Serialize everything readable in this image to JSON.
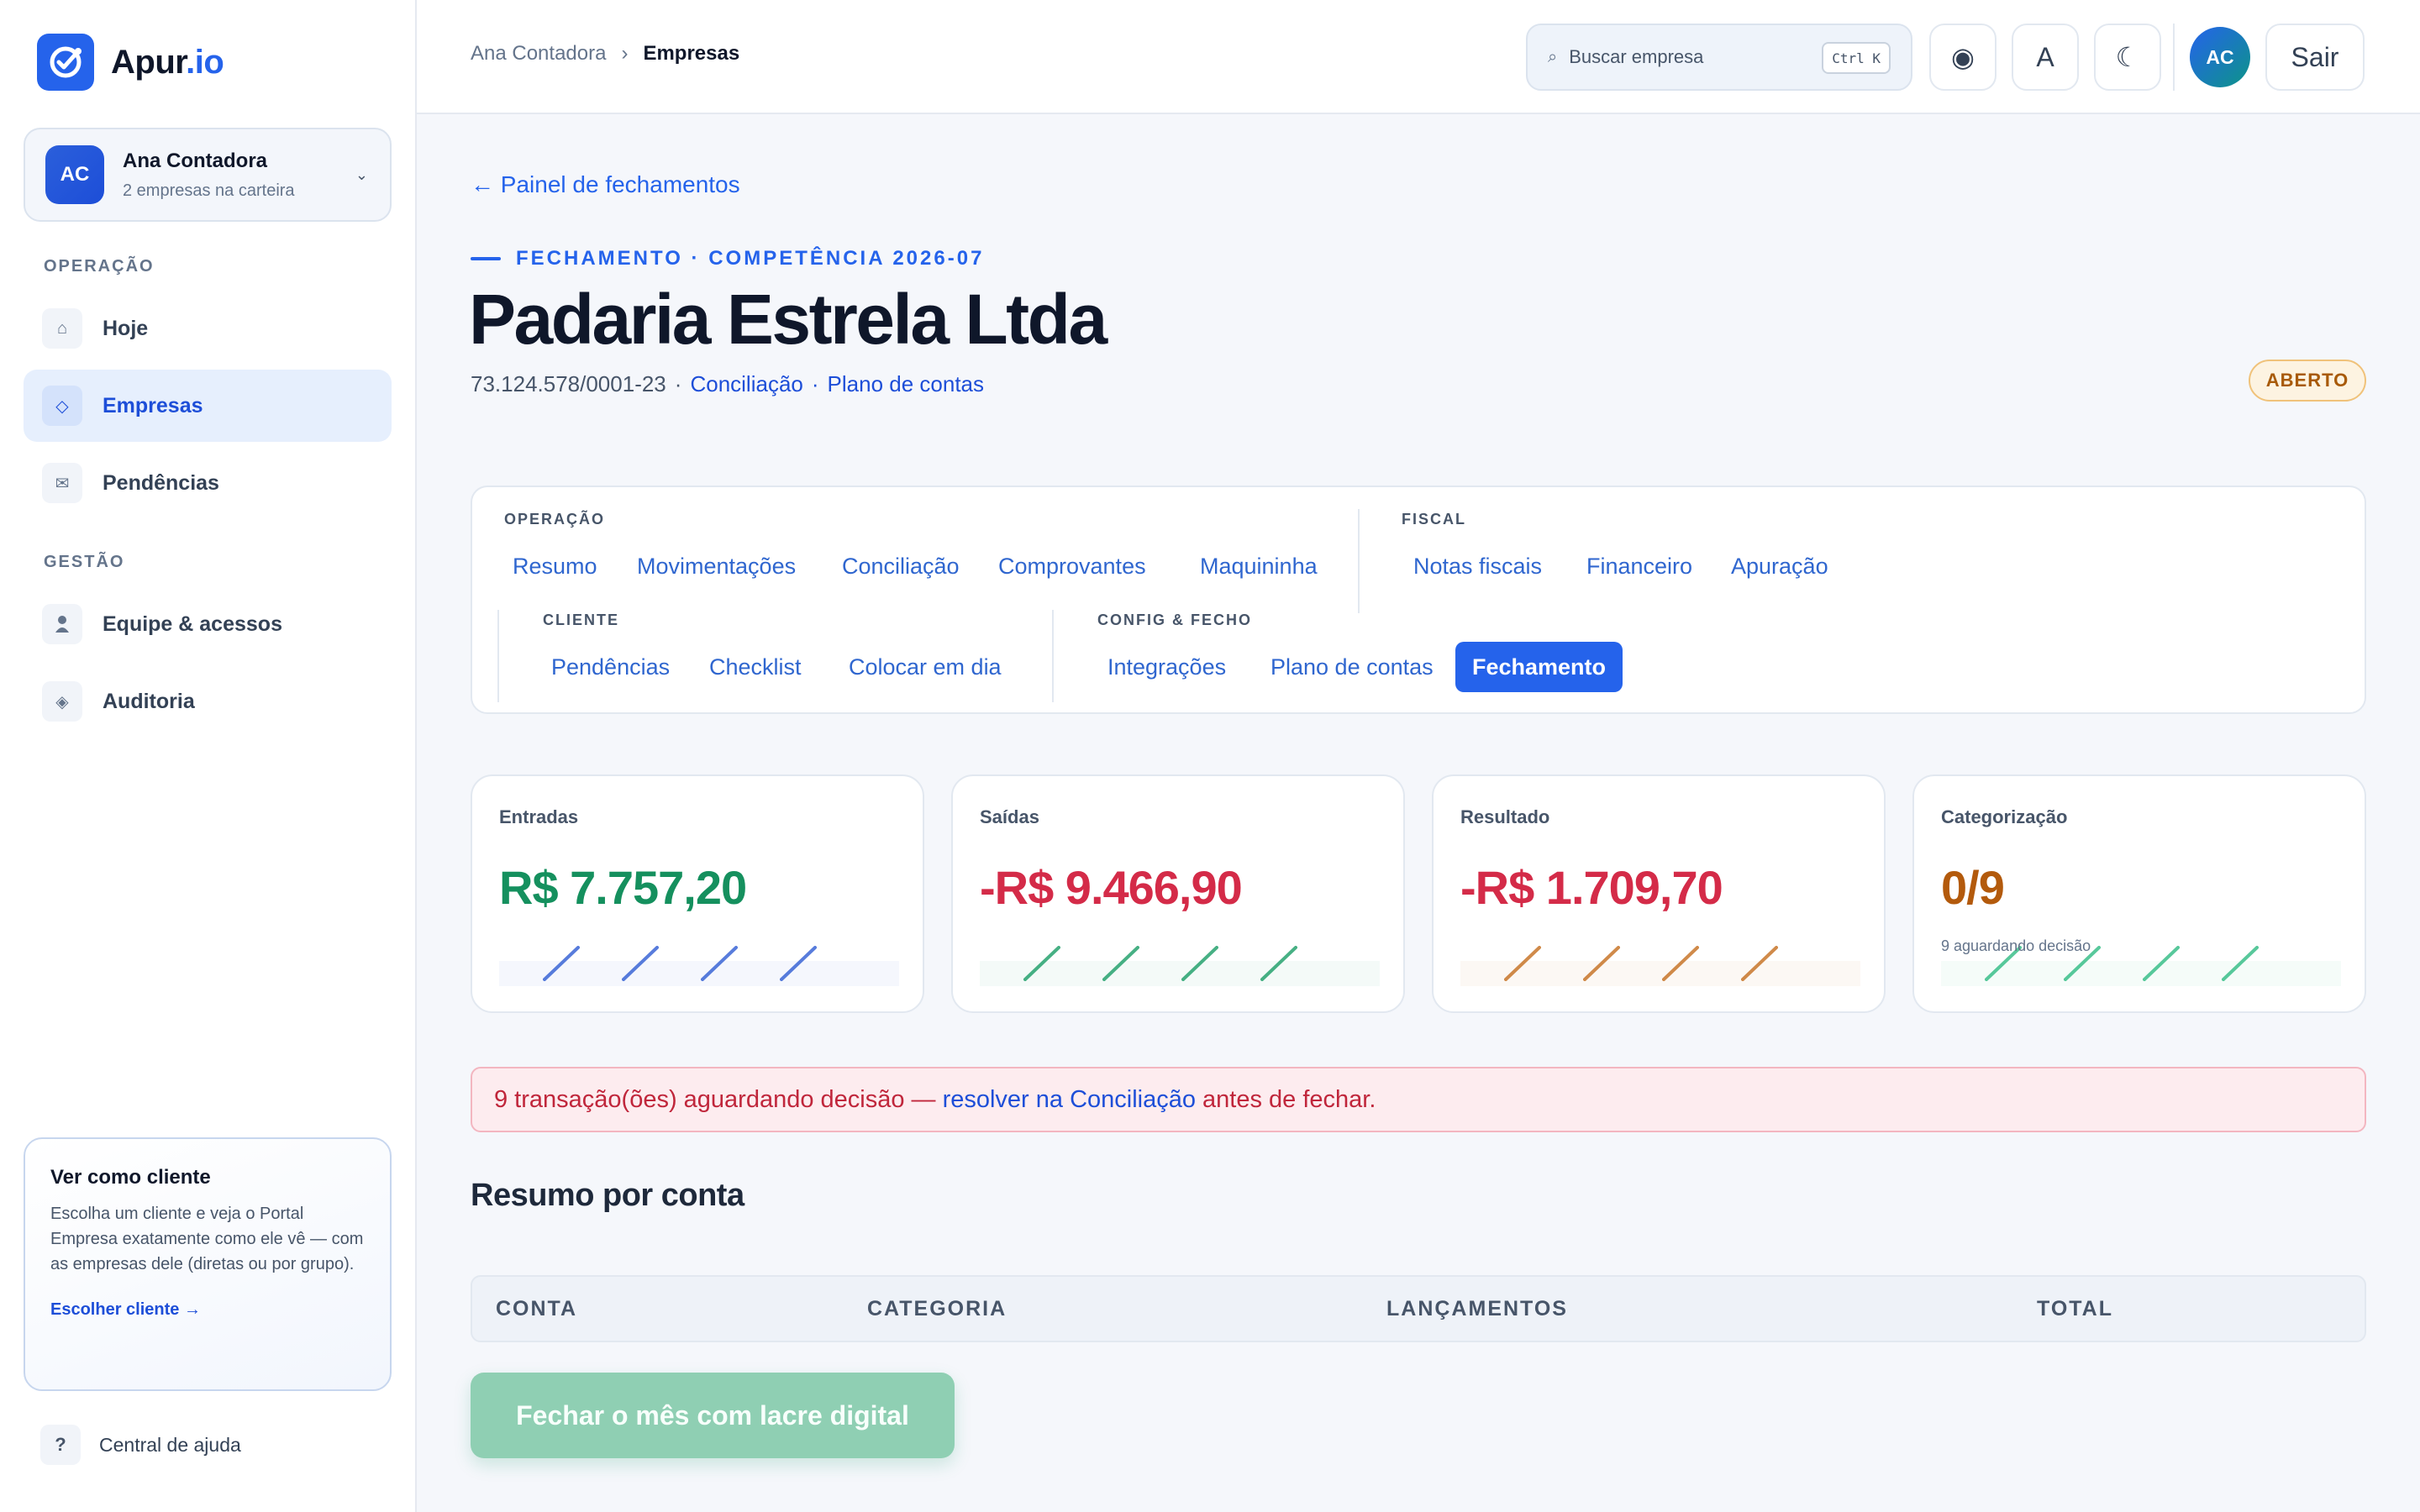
{
  "brand": {
    "name_main": "Apur",
    "name_accent": ".io"
  },
  "account": {
    "initials": "AC",
    "name": "Ana Contadora",
    "subtitle": "2 empresas na carteira"
  },
  "sidebar": {
    "sections": [
      "OPERAÇÃO",
      "GESTÃO"
    ],
    "items": [
      {
        "label": "Hoje",
        "icon": "home-icon",
        "glyph": "⌂"
      },
      {
        "label": "Empresas",
        "icon": "diamond-icon",
        "glyph": "◇"
      },
      {
        "label": "Pendências",
        "icon": "mail-icon",
        "glyph": "✉"
      },
      {
        "label": "Equipe & acessos",
        "icon": "user-icon",
        "glyph": "👤"
      },
      {
        "label": "Auditoria",
        "icon": "audit-icon",
        "glyph": "◈"
      }
    ],
    "active_item": "Empresas"
  },
  "client_card": {
    "title": "Ver como cliente",
    "description": "Escolha um cliente e veja o Portal Empresa exatamente como ele vê — com as empresas dele (diretas ou por grupo).",
    "link": "Escolher cliente →"
  },
  "help": {
    "icon_glyph": "?",
    "label": "Central de ajuda"
  },
  "topbar": {
    "breadcrumb": [
      "Ana Contadora",
      "›",
      "Empresas"
    ],
    "search": {
      "placeholder": "Buscar empresa",
      "shortcut": "Ctrl K"
    },
    "buttons": {
      "record": "◉",
      "font": "A",
      "theme": "☾"
    },
    "avatar": "AC",
    "logout": "Sair"
  },
  "page": {
    "back_link": "← Painel de fechamentos",
    "eyebrow": "FECHAMENTO · COMPETÊNCIA 2026-07",
    "title": "Padaria Estrela Ltda",
    "cnpj": "73.124.578/0001-23",
    "sep": "·",
    "links": [
      "Conciliação",
      "Plano de contas"
    ],
    "status": "ABERTO"
  },
  "tabs": {
    "groups": [
      {
        "label": "OPERAÇÃO",
        "items": [
          "Resumo",
          "Movimentações",
          "Conciliação",
          "Comprovantes",
          "Maquininha"
        ]
      },
      {
        "label": "FISCAL",
        "items": [
          "Notas fiscais",
          "Financeiro",
          "Apuração"
        ]
      },
      {
        "label": "CLIENTE",
        "items": [
          "Pendências",
          "Checklist",
          "Colocar em dia"
        ]
      },
      {
        "label": "CONFIG & FECHO",
        "items": [
          "Integrações",
          "Plano de contas",
          "Fechamento"
        ]
      }
    ],
    "active": "Fechamento"
  },
  "stats": [
    {
      "label": "Entradas",
      "value": "R$ 7.757,20",
      "color": "#15905e",
      "spark": "#3b66d6"
    },
    {
      "label": "Saídas",
      "value": "-R$ 9.466,90",
      "color": "#d42b48",
      "spark": "#27a36f"
    },
    {
      "label": "Resultado",
      "value": "-R$ 1.709,70",
      "color": "#d42b48",
      "spark": "#c8762b"
    },
    {
      "label": "Categorização",
      "value": "0/9",
      "sub": "9 aguardando decisão",
      "color": "#b35a0c",
      "spark": "#3bbf8a"
    }
  ],
  "alert": {
    "before": "9 transação(ões) aguardando decisão —",
    "link": "resolver na Conciliação",
    "after": "antes de fechar."
  },
  "summary": {
    "title": "Resumo por conta",
    "columns": [
      "CONTA",
      "CATEGORIA",
      "LANÇAMENTOS",
      "TOTAL"
    ]
  },
  "close_button": "Fechar o mês com lacre digital",
  "colors": {
    "accent": "#2563eb",
    "success": "#15905e",
    "danger": "#d42b48",
    "warning": "#b35a0c"
  }
}
